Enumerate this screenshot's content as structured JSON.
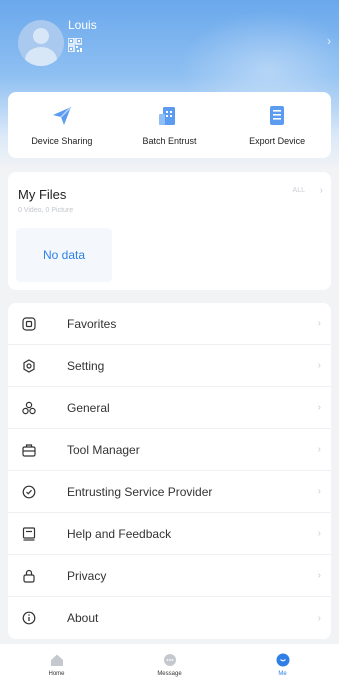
{
  "profile": {
    "username": "Louis"
  },
  "quick_actions": [
    {
      "label": "Device Sharing",
      "icon": "send-plane-icon"
    },
    {
      "label": "Batch Entrust",
      "icon": "building-icon"
    },
    {
      "label": "Export Device",
      "icon": "document-list-icon"
    }
  ],
  "files": {
    "title": "My Files",
    "subtitle": "0 Video,   0 Picture",
    "all_label": "ALL",
    "empty_text": "No data"
  },
  "menu": {
    "items": [
      {
        "label": "Favorites",
        "icon": "favorites-icon"
      },
      {
        "label": "Setting",
        "icon": "gear-icon"
      },
      {
        "label": "General",
        "icon": "general-icon"
      },
      {
        "label": "Tool Manager",
        "icon": "toolbox-icon"
      },
      {
        "label": "Entrusting Service Provider",
        "icon": "service-provider-icon"
      },
      {
        "label": "Help and Feedback",
        "icon": "feedback-icon"
      },
      {
        "label": "Privacy",
        "icon": "lock-icon"
      },
      {
        "label": "About",
        "icon": "info-icon"
      }
    ]
  },
  "tabbar": {
    "tabs": [
      {
        "label": "Home",
        "icon": "home-icon",
        "active": false
      },
      {
        "label": "Message",
        "icon": "message-icon",
        "active": false
      },
      {
        "label": "Me",
        "icon": "me-icon",
        "active": true
      }
    ]
  },
  "colors": {
    "accent": "#2f7fe6",
    "header_gradient_top": "#6aa8ec",
    "background": "#f2f3f5"
  }
}
